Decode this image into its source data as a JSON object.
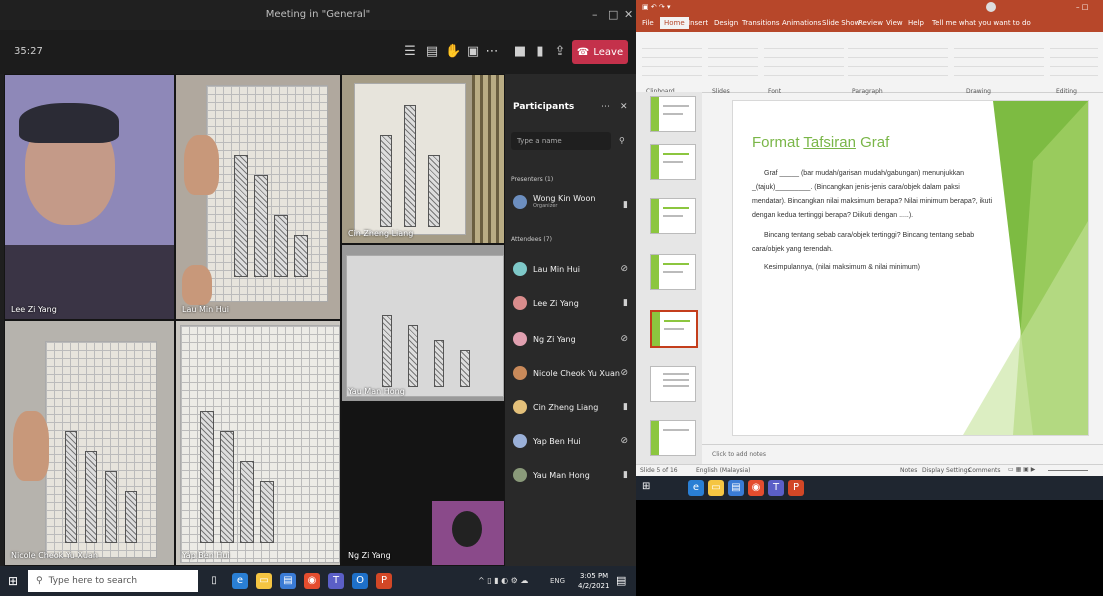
{
  "teams": {
    "title": "Meeting in \"General\"",
    "timer": "35:27",
    "leave_label": "Leave",
    "tiles": [
      {
        "name": "Lee Zi Yang"
      },
      {
        "name": "Lau Min Hui"
      },
      {
        "name": "Cin Zheng Liang"
      },
      {
        "name": "Yau Man Hong"
      },
      {
        "name": "Nicole Cheok Yu Xuan"
      },
      {
        "name": "Yap Ben Hui"
      },
      {
        "name": "Ng Zi Yang"
      }
    ],
    "participants": {
      "heading": "Participants",
      "search_placeholder": "Type a name",
      "presenters_label": "Presenters (1)",
      "presenter": {
        "name": "Wong Kin Woon",
        "role": "Organizer"
      },
      "attendees_label": "Attendees (7)",
      "attendees": [
        "Lau Min Hui",
        "Lee Zi Yang",
        "Ng Zi Yang",
        "Nicole Cheok Yu Xuan",
        "Cin Zheng Liang",
        "Yap Ben Hui",
        "Yau Man Hong"
      ]
    }
  },
  "taskbar": {
    "search_placeholder": "Type here to search",
    "time": "3:05 PM",
    "date": "4/2/2021",
    "lang": "ENG"
  },
  "ppt": {
    "tabs": [
      "File",
      "Home",
      "Insert",
      "Design",
      "Transitions",
      "Animations",
      "Slide Show",
      "Review",
      "View",
      "Help"
    ],
    "tell_me": "Tell me what you want to do",
    "ribbon_groups": [
      "Clipboard",
      "Slides",
      "Font",
      "Paragraph",
      "Drawing",
      "Editing"
    ],
    "slide": {
      "title_part1": "Format ",
      "title_part2": "Tafsiran",
      "title_part3": " Graf",
      "lines": [
        "Graf _____ (bar mudah/garisan mudah/gabungan) menunjukkan",
        "_(tajuk)_________. (Bincangkan jenis-jenis cara/objek dalam paksi",
        "mendatar). Bincangkan nilai maksimum berapa? Nilai minimum berapa?, ikuti",
        "dengan kedua tertinggi berapa? Diikuti dengan .....).",
        "Bincang tentang sebab cara/objek tertinggi? Bincang tentang sebab",
        "cara/objek yang terendah.",
        "Kesimpulannya, (nilai maksimum & nilai minimum)"
      ]
    },
    "notes_placeholder": "Click to add notes",
    "status": "Slide 5 of 16",
    "lang": "English (Malaysia)",
    "notes_btn": "Notes",
    "display_btn": "Display Settings",
    "comments_btn": "Comments"
  }
}
